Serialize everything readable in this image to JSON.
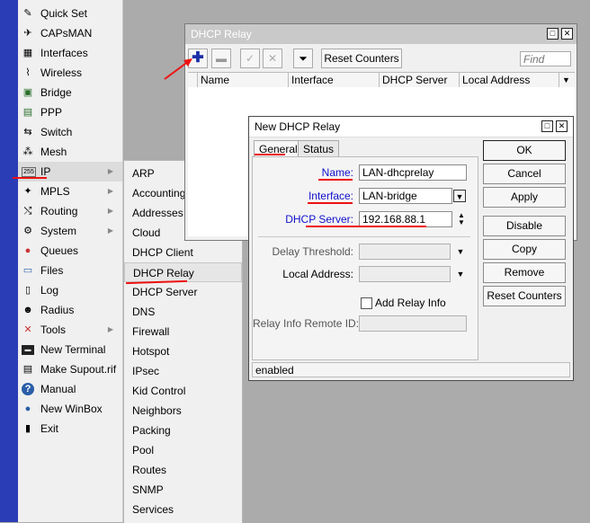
{
  "main_menu": {
    "items": [
      {
        "label": "Quick Set",
        "icon": "wrench-icon",
        "glyph": "✎",
        "arrow": false
      },
      {
        "label": "CAPsMAN",
        "icon": "capsman-icon",
        "glyph": "✈",
        "arrow": false
      },
      {
        "label": "Interfaces",
        "icon": "interfaces-icon",
        "glyph": "▦",
        "arrow": false
      },
      {
        "label": "Wireless",
        "icon": "wireless-icon",
        "glyph": "⌇",
        "arrow": false
      },
      {
        "label": "Bridge",
        "icon": "bridge-icon",
        "glyph": "▣",
        "arrow": false
      },
      {
        "label": "PPP",
        "icon": "ppp-icon",
        "glyph": "▤",
        "arrow": false
      },
      {
        "label": "Switch",
        "icon": "switch-icon",
        "glyph": "⇆",
        "arrow": false
      },
      {
        "label": "Mesh",
        "icon": "mesh-icon",
        "glyph": "⁂",
        "arrow": false
      },
      {
        "label": "IP",
        "icon": "ip-icon",
        "glyph": "255",
        "arrow": true
      },
      {
        "label": "MPLS",
        "icon": "mpls-icon",
        "glyph": "✦",
        "arrow": true
      },
      {
        "label": "Routing",
        "icon": "routing-icon",
        "glyph": "⤭",
        "arrow": true
      },
      {
        "label": "System",
        "icon": "system-icon",
        "glyph": "⚙",
        "arrow": true
      },
      {
        "label": "Queues",
        "icon": "queues-icon",
        "glyph": "●",
        "arrow": false
      },
      {
        "label": "Files",
        "icon": "files-icon",
        "glyph": "▭",
        "arrow": false
      },
      {
        "label": "Log",
        "icon": "log-icon",
        "glyph": "▯",
        "arrow": false
      },
      {
        "label": "Radius",
        "icon": "radius-icon",
        "glyph": "☻",
        "arrow": false
      },
      {
        "label": "Tools",
        "icon": "tools-icon",
        "glyph": "✕",
        "arrow": true
      },
      {
        "label": "New Terminal",
        "icon": "terminal-icon",
        "glyph": "▬",
        "arrow": false
      },
      {
        "label": "Make Supout.rif",
        "icon": "supout-icon",
        "glyph": "▤",
        "arrow": false
      },
      {
        "label": "Manual",
        "icon": "manual-icon",
        "glyph": "?",
        "arrow": false
      },
      {
        "label": "New WinBox",
        "icon": "winbox-icon",
        "glyph": "●",
        "arrow": false
      },
      {
        "label": "Exit",
        "icon": "exit-icon",
        "glyph": "▮",
        "arrow": false
      }
    ]
  },
  "ip_submenu": {
    "items": [
      "ARP",
      "Accounting",
      "Addresses",
      "Cloud",
      "DHCP Client",
      "DHCP Relay",
      "DHCP Server",
      "DNS",
      "Firewall",
      "Hotspot",
      "IPsec",
      "Kid Control",
      "Neighbors",
      "Packing",
      "Pool",
      "Routes",
      "SNMP",
      "Services"
    ],
    "highlighted": "DHCP Relay"
  },
  "dhcp_relay_window": {
    "title": "DHCP Relay",
    "reset_counters_label": "Reset Counters",
    "find_placeholder": "Find",
    "columns": [
      "Name",
      "Interface",
      "DHCP Server",
      "Local Address"
    ]
  },
  "new_dhcp_relay_dialog": {
    "title": "New DHCP Relay",
    "tabs": [
      "General",
      "Status"
    ],
    "fields": {
      "name": {
        "label": "Name:",
        "value": "LAN-dhcprelay"
      },
      "interface": {
        "label": "Interface:",
        "value": "LAN-bridge"
      },
      "dhcp_server": {
        "label": "DHCP Server:",
        "value": "192.168.88.1"
      },
      "delay_threshold": {
        "label": "Delay Threshold:",
        "value": ""
      },
      "local_address": {
        "label": "Local Address:",
        "value": ""
      },
      "add_relay_info": {
        "label": "Add Relay Info",
        "checked": false
      },
      "relay_info_remote_id": {
        "label": "Relay Info Remote ID:",
        "value": ""
      }
    },
    "buttons": [
      "OK",
      "Cancel",
      "Apply",
      "Disable",
      "Copy",
      "Remove",
      "Reset Counters"
    ],
    "status": "enabled"
  },
  "colors": {
    "accent_red": "#ee1111",
    "menu_strip_blue": "#2b3db6",
    "label_blue": "#1010cc"
  }
}
